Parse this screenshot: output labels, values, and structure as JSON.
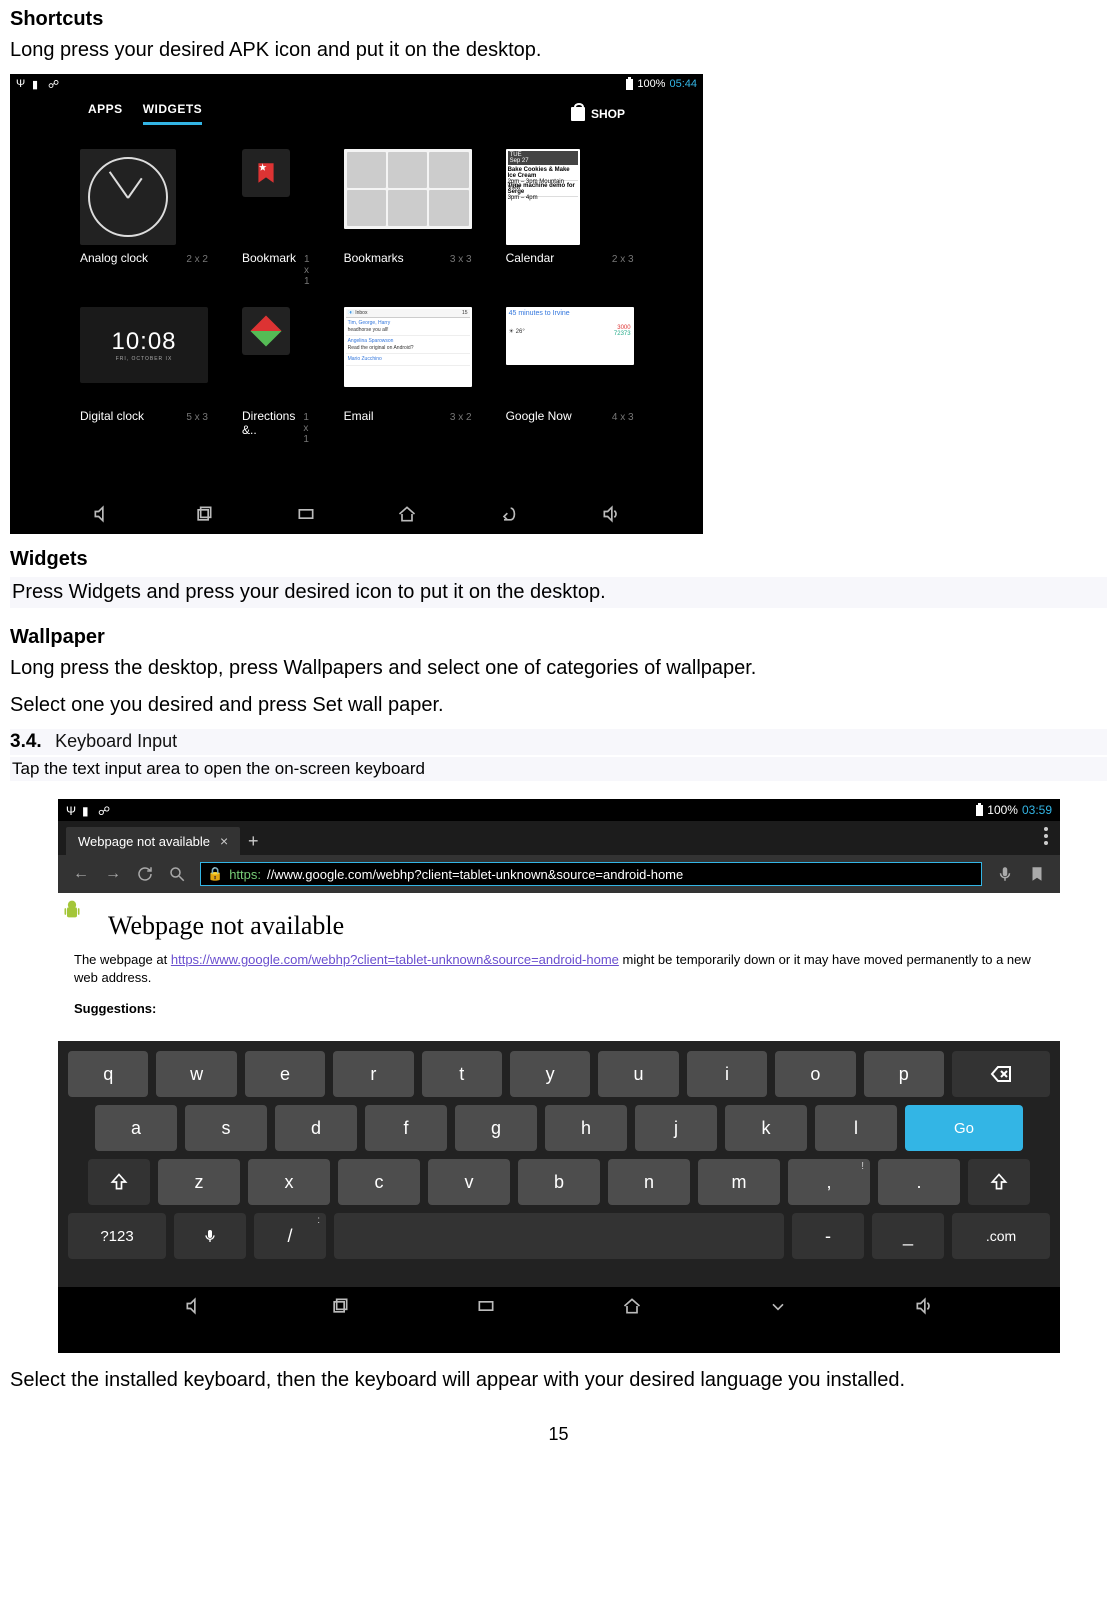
{
  "doc": {
    "h_shortcuts": "Shortcuts",
    "p_shortcuts": "Long press your desired APK icon and put it on the desktop.",
    "h_widgets": "Widgets",
    "p_widgets": "Press Widgets and press your desired icon to put it on the desktop.",
    "h_wallpaper": "Wallpaper",
    "p_wallpaper1": "Long press the desktop, press Wallpapers and select one of categories of wallpaper.",
    "p_wallpaper2": "Select one you desired and press Set wall paper.",
    "sec_num": "3.4.",
    "sec_title": "Keyboard Input",
    "sec_sub": "Tap the text input area to open the on-screen keyboard",
    "p_after2": "Select the installed keyboard, then the keyboard will appear with your desired language you installed.",
    "page_number": "15"
  },
  "shot1": {
    "status": {
      "battery": "100%",
      "time": "05:44"
    },
    "tabs": {
      "apps": "APPS",
      "widgets": "WIDGETS",
      "shop": "SHOP"
    },
    "widgets": [
      {
        "name": "Analog clock",
        "dim": "2 x 2"
      },
      {
        "name": "Bookmark",
        "dim": "1 x 1"
      },
      {
        "name": "Bookmarks",
        "dim": "3 x 3"
      },
      {
        "name": "Calendar",
        "dim": "2 x 3"
      },
      {
        "name": "Digital clock",
        "dim": "5 x 3"
      },
      {
        "name": "Directions &..",
        "dim": "1 x 1"
      },
      {
        "name": "Email",
        "dim": "3 x 2"
      },
      {
        "name": "Google Now",
        "dim": "4 x 3"
      }
    ],
    "cal": {
      "day_label": "TUE",
      "day": "Sep 27",
      "l1": "Bake Cookies & Make Ice Cream",
      "l1t": "2pm – 3pm Mountain View",
      "l2": "Time machine demo for Serge",
      "l2t": "3pm – 4pm"
    },
    "dclock": {
      "time": "10:08",
      "sub": "FRI, OCTOBER IX"
    },
    "email": {
      "inbox": "Inbox",
      "count": "15",
      "r1a": "Tim, George, Harry",
      "r1b": "headhorse you all!",
      "r2a": "Angelina Sparowson",
      "r2b": "Read the original on Android?",
      "r3a": "Mario Zucchino"
    },
    "gnow": {
      "l1": "45 minutes to Irvine",
      "l2": "26°",
      "l3": "3000",
      "l4": "72373"
    }
  },
  "shot2": {
    "status": {
      "battery": "100%",
      "time": "03:59"
    },
    "tab": {
      "title": "Webpage not available",
      "close": "×",
      "plus": "+"
    },
    "url": {
      "proto": "https:",
      "rest": "//www.google.com/webhp?client=tablet-unknown&source=android-home"
    },
    "page": {
      "heading": "Webpage not available",
      "pre": "The webpage at ",
      "link": "https://www.google.com/webhp?client=tablet-unknown&source=android-home",
      "post": " might be temporarily down or it may have moved permanently to a new web address.",
      "sugg": "Suggestions:"
    },
    "kbd": {
      "row1": [
        "q",
        "w",
        "e",
        "r",
        "t",
        "y",
        "u",
        "i",
        "o",
        "p"
      ],
      "row2": [
        "a",
        "s",
        "d",
        "f",
        "g",
        "h",
        "j",
        "k",
        "l"
      ],
      "go": "Go",
      "row3": [
        "z",
        "x",
        "c",
        "v",
        "b",
        "n",
        "m",
        ",",
        "."
      ],
      "row3_sup": {
        ",": "!",
        ".": "?"
      },
      "sym": "?123",
      "slash": "/",
      "slash_sup": ":",
      "dash": "-",
      "under": "_",
      "com": ".com"
    }
  }
}
